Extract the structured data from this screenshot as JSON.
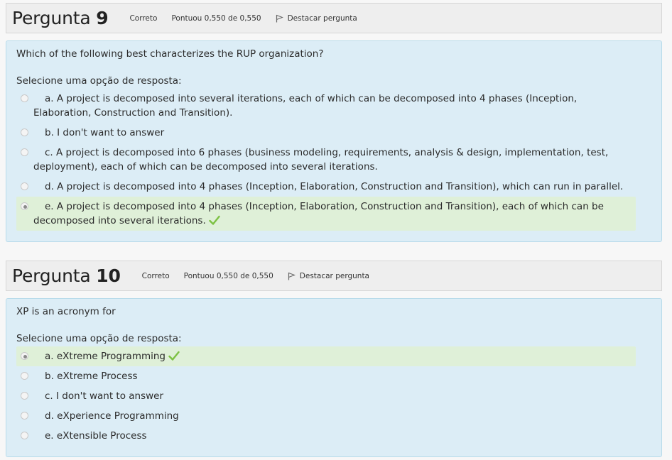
{
  "questions": [
    {
      "title_prefix": "Pergunta",
      "number": "9",
      "status": "Correto",
      "score": "Pontuou 0,550 de 0,550",
      "flag_label": "Destacar pergunta",
      "question_text": "Which of the following best characterizes the RUP organization?",
      "prompt": "Selecione uma opção de resposta:",
      "answers": [
        {
          "label": "a. A project is decomposed into several iterations, each of which can be decomposed into 4 phases (Inception, Elaboration, Construction and Transition).",
          "selected": false,
          "correct": false
        },
        {
          "label": "b. I don't want to answer",
          "selected": false,
          "correct": false
        },
        {
          "label": "c. A project is decomposed into 6 phases (business modeling, requirements, analysis & design, implementation, test, deployment), each of which can be decomposed into several iterations.",
          "selected": false,
          "correct": false
        },
        {
          "label": "d. A project is decomposed into 4 phases (Inception, Elaboration, Construction and Transition), which can run in parallel.",
          "selected": false,
          "correct": false
        },
        {
          "label": "e. A project is decomposed into 4 phases (Inception, Elaboration, Construction and Transition), each of which can be decomposed into several iterations.",
          "selected": true,
          "correct": true
        }
      ]
    },
    {
      "title_prefix": "Pergunta",
      "number": "10",
      "status": "Correto",
      "score": "Pontuou 0,550 de 0,550",
      "flag_label": "Destacar pergunta",
      "question_text": "XP is an acronym for",
      "prompt": "Selecione uma opção de resposta:",
      "answers": [
        {
          "label": "a. eXtreme Programming",
          "selected": true,
          "correct": true
        },
        {
          "label": "b. eXtreme Process",
          "selected": false,
          "correct": false
        },
        {
          "label": "c. I don't want to answer",
          "selected": false,
          "correct": false
        },
        {
          "label": "d. eXperience Programming",
          "selected": false,
          "correct": false
        },
        {
          "label": "e. eXtensible Process",
          "selected": false,
          "correct": false
        }
      ]
    }
  ],
  "colors": {
    "header_bg": "#eeeeee",
    "body_bg": "#dcedf6",
    "correct_bg": "#dff0d8",
    "check": "#7cc142"
  },
  "icons": {
    "flag": "flag-icon",
    "check": "check-icon",
    "radio": "radio-icon"
  }
}
